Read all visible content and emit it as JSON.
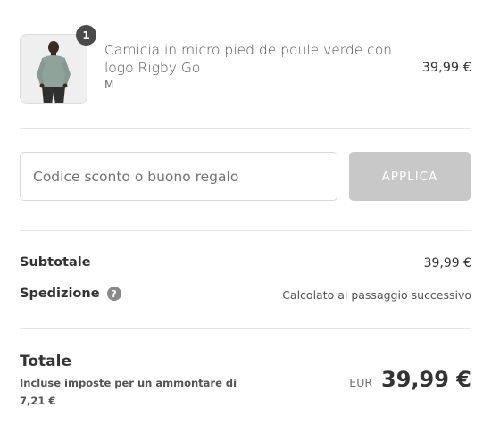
{
  "cart_item": {
    "quantity": "1",
    "name": "Camicia in micro pied de poule verde con logo Rigby Go",
    "variant": "M",
    "price": "39,99 €"
  },
  "discount": {
    "placeholder": "Codice sconto o buono regalo",
    "apply_label": "APPLICA"
  },
  "summary": {
    "subtotal_label": "Subtotale",
    "subtotal_value": "39,99 €",
    "shipping_label": "Spedizione",
    "shipping_value": "Calcolato al passaggio successivo",
    "help_glyph": "?"
  },
  "total": {
    "label": "Totale",
    "tax_note": "Incluse imposte per un ammontare di 7,21 €",
    "currency": "EUR",
    "amount": "39,99 €"
  }
}
